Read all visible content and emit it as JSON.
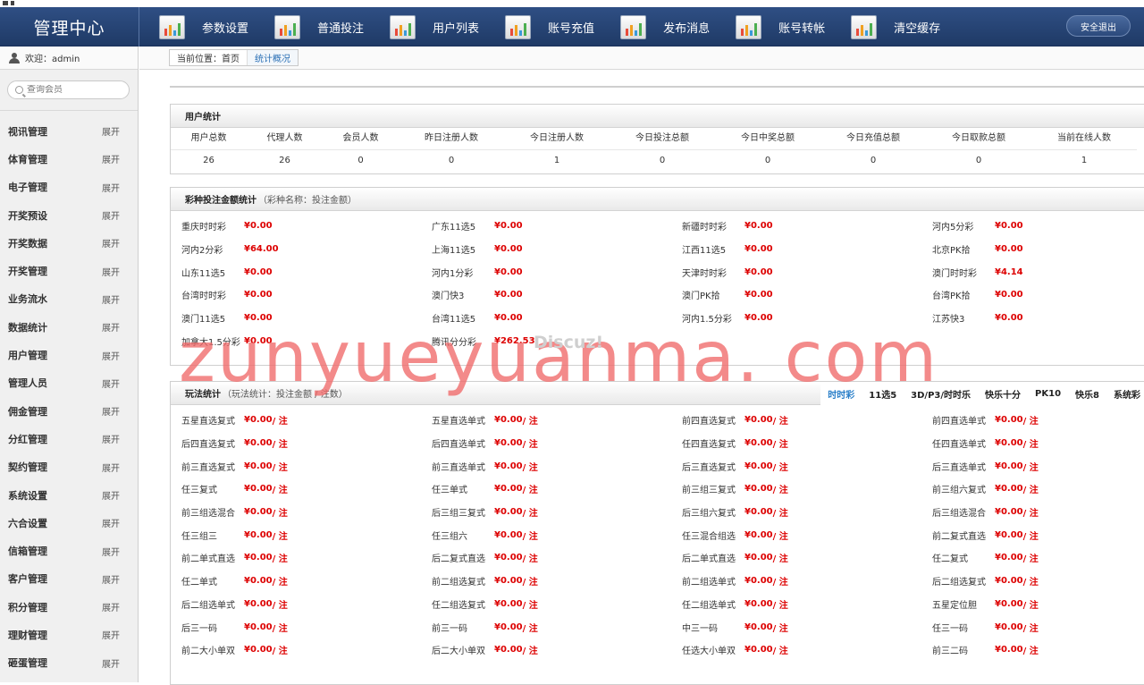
{
  "brand": "管理中心",
  "nav": [
    "参数设置",
    "普通投注",
    "用户列表",
    "账号充值",
    "发布消息",
    "账号转帐",
    "清空缓存"
  ],
  "logout": "安全退出",
  "welcome": "欢迎：admin",
  "search_placeholder": "查询会员",
  "menu_toggle": "展开",
  "menu": [
    "视讯管理",
    "体育管理",
    "电子管理",
    "开奖预设",
    "开奖数据",
    "开奖管理",
    "业务流水",
    "数据统计",
    "用户管理",
    "管理人员",
    "佣金管理",
    "分红管理",
    "契约管理",
    "系统设置",
    "六合设置",
    "信箱管理",
    "客户管理",
    "积分管理",
    "理财管理",
    "砸蛋管理"
  ],
  "breadcrumb": {
    "label": "当前位置：首页",
    "current": "统计概况"
  },
  "user_stats": {
    "title": "用户统计",
    "headers": [
      "用户总数",
      "代理人数",
      "会员人数",
      "昨日注册人数",
      "今日注册人数",
      "今日投注总额",
      "今日中奖总额",
      "今日充值总额",
      "今日取款总额",
      "当前在线人数"
    ],
    "values": [
      "26",
      "26",
      "0",
      "0",
      "1",
      "0",
      "0",
      "0",
      "0",
      "1"
    ]
  },
  "lottery_stats": {
    "title": "彩种投注金额统计",
    "subtitle": "（彩种名称：投注金额）",
    "items": [
      {
        "name": "重庆时时彩",
        "amount": "¥0.00"
      },
      {
        "name": "广东11选5",
        "amount": "¥0.00"
      },
      {
        "name": "新疆时时彩",
        "amount": "¥0.00"
      },
      {
        "name": "河内5分彩",
        "amount": "¥0.00"
      },
      {
        "name": "河内2分彩",
        "amount": "¥64.00"
      },
      {
        "name": "上海11选5",
        "amount": "¥0.00"
      },
      {
        "name": "江西11选5",
        "amount": "¥0.00"
      },
      {
        "name": "北京PK拾",
        "amount": "¥0.00"
      },
      {
        "name": "山东11选5",
        "amount": "¥0.00"
      },
      {
        "name": "河内1分彩",
        "amount": "¥0.00"
      },
      {
        "name": "天津时时彩",
        "amount": "¥0.00"
      },
      {
        "name": "澳门时时彩",
        "amount": "¥4.14"
      },
      {
        "name": "台湾时时彩",
        "amount": "¥0.00"
      },
      {
        "name": "澳门快3",
        "amount": "¥0.00"
      },
      {
        "name": "澳门PK拾",
        "amount": "¥0.00"
      },
      {
        "name": "台湾PK拾",
        "amount": "¥0.00"
      },
      {
        "name": "澳门11选5",
        "amount": "¥0.00"
      },
      {
        "name": "台湾11选5",
        "amount": "¥0.00"
      },
      {
        "name": "河内1.5分彩",
        "amount": "¥0.00"
      },
      {
        "name": "江苏快3",
        "amount": "¥0.00"
      },
      {
        "name": "加拿大1.5分彩",
        "amount": "¥0.00"
      },
      {
        "name": "腾讯分分彩",
        "amount": "¥262.53"
      }
    ]
  },
  "play_stats": {
    "title": "玩法统计",
    "subtitle": "（玩法统计：投注金额 / 注数）",
    "tabs": [
      "时时彩",
      "11选5",
      "3D/P3/时时乐",
      "快乐十分",
      "PK10",
      "快乐8",
      "系统彩"
    ],
    "active_tab": "时时彩",
    "value": "¥0.00",
    "unit": " / 注",
    "items": [
      "五星直选复式",
      "五星直选单式",
      "前四直选复式",
      "前四直选单式",
      "后四直选复式",
      "后四直选单式",
      "任四直选复式",
      "任四直选单式",
      "前三直选复式",
      "前三直选单式",
      "后三直选复式",
      "后三直选单式",
      "任三复式",
      "任三单式",
      "前三组三复式",
      "前三组六复式",
      "前三组选混合",
      "后三组三复式",
      "后三组六复式",
      "后三组选混合",
      "任三组三",
      "任三组六",
      "任三混合组选",
      "前二复式直选",
      "前二单式直选",
      "后二复式直选",
      "后二单式直选",
      "任二复式",
      "任二单式",
      "前二组选复式",
      "前二组选单式",
      "后二组选复式",
      "后二组选单式",
      "任二组选复式",
      "任二组选单式",
      "五星定位胆",
      "后三一码",
      "前三一码",
      "中三一码",
      "任三一码",
      "前二大小单双",
      "后二大小单双",
      "任选大小单双",
      "前三二码"
    ]
  },
  "watermark": "zunyueyuanma. com",
  "watermark2": "Discuz!"
}
